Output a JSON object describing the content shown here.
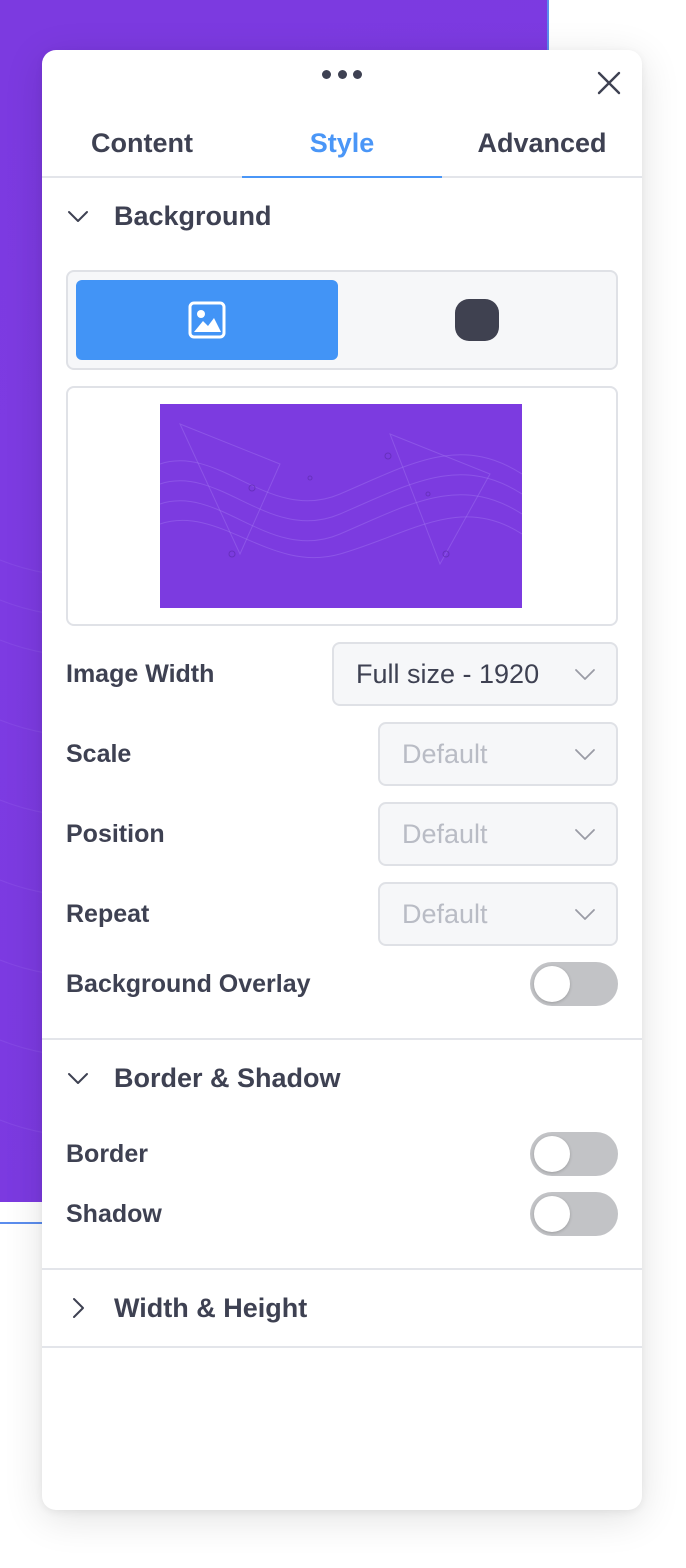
{
  "panel": {
    "icons": {
      "drag": "drag-handle-dots-icon",
      "close": "close-icon"
    }
  },
  "tabs": [
    {
      "label": "Content",
      "active": false
    },
    {
      "label": "Style",
      "active": true
    },
    {
      "label": "Advanced",
      "active": false
    }
  ],
  "background_section": {
    "title": "Background",
    "expanded": true,
    "type_options": [
      {
        "icon": "image-icon",
        "selected": true
      },
      {
        "icon": "color-swatch-icon",
        "selected": false
      }
    ],
    "preview_icon": "background-image-preview",
    "fields": {
      "image_width": {
        "label": "Image Width",
        "value": "Full size - 1920"
      },
      "scale": {
        "label": "Scale",
        "value": "Default"
      },
      "position": {
        "label": "Position",
        "value": "Default"
      },
      "repeat": {
        "label": "Repeat",
        "value": "Default"
      }
    },
    "overlay": {
      "label": "Background Overlay",
      "enabled": false
    }
  },
  "border_section": {
    "title": "Border & Shadow",
    "expanded": true,
    "border": {
      "label": "Border",
      "enabled": false
    },
    "shadow": {
      "label": "Shadow",
      "enabled": false
    }
  },
  "size_section": {
    "title": "Width & Height",
    "expanded": false
  },
  "colors": {
    "accent": "#4a96f7",
    "canvas": "#7c3be0",
    "text": "#3e4152",
    "muted": "#b9bcc5"
  }
}
